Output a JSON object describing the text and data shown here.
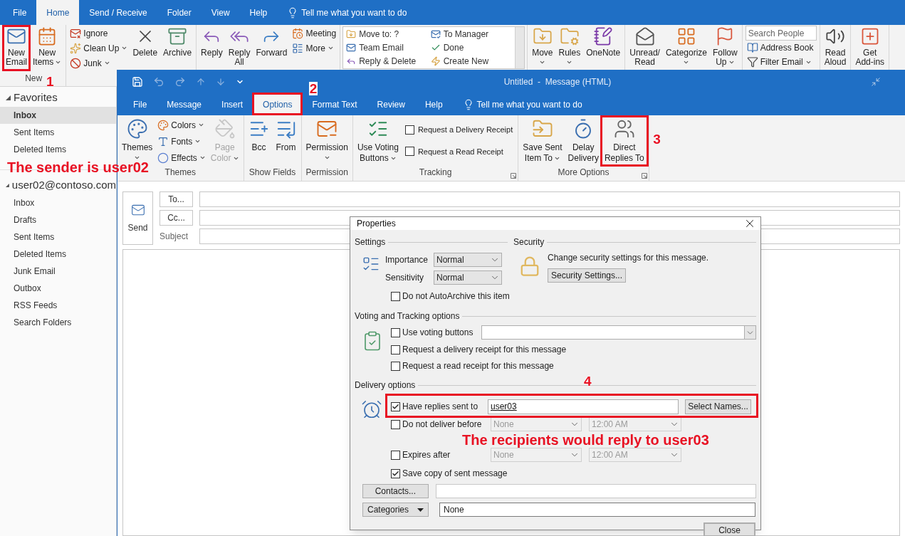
{
  "main_window": {
    "tabs": [
      {
        "label": "File",
        "selected": false
      },
      {
        "label": "Home",
        "selected": true
      },
      {
        "label": "Send / Receive",
        "selected": false
      },
      {
        "label": "Folder",
        "selected": false
      },
      {
        "label": "View",
        "selected": false
      },
      {
        "label": "Help",
        "selected": false
      }
    ],
    "tell_me": "Tell me what you want to do",
    "ribbon_groups": [
      {
        "label": "New",
        "items": [
          {
            "kind": "large",
            "label": "New\nEmail",
            "dropdown": false
          },
          {
            "kind": "large",
            "label": "New\nItems",
            "dropdown": true
          }
        ]
      },
      {
        "items": [
          {
            "kind": "stack",
            "items": [
              {
                "label": "Ignore",
                "dropdown": false
              },
              {
                "label": "Clean Up",
                "dropdown": true
              },
              {
                "label": "Junk",
                "dropdown": true
              }
            ]
          },
          {
            "kind": "large",
            "label": "Delete",
            "dropdown": false
          },
          {
            "kind": "large",
            "label": "Archive",
            "dropdown": false
          }
        ]
      },
      {
        "items": [
          {
            "kind": "large",
            "label": "Reply",
            "dropdown": false
          },
          {
            "kind": "large",
            "label": "Reply\nAll",
            "dropdown": false
          },
          {
            "kind": "large",
            "label": "Forward",
            "dropdown": false
          },
          {
            "kind": "stack",
            "items": [
              {
                "label": "Meeting",
                "dropdown": false
              },
              {
                "label": "More",
                "dropdown": true
              }
            ]
          }
        ]
      },
      {
        "items": [
          {
            "kind": "quicksteps",
            "items": [
              "Move to: ?",
              "To Manager",
              "Team Email",
              "Done",
              "Reply & Delete",
              "Create New"
            ]
          }
        ]
      },
      {
        "items": [
          {
            "kind": "large",
            "label": "Move",
            "dropdown": true
          },
          {
            "kind": "large",
            "label": "Rules",
            "dropdown": true
          },
          {
            "kind": "large",
            "label": "OneNote",
            "dropdown": false
          }
        ]
      },
      {
        "items": [
          {
            "kind": "large",
            "label": "Unread/\nRead",
            "dropdown": false
          },
          {
            "kind": "large",
            "label": "Categorize",
            "dropdown": true
          },
          {
            "kind": "large",
            "label": "Follow\nUp",
            "dropdown": true
          }
        ]
      },
      {
        "items": [
          {
            "kind": "search",
            "placeholder": "Search People"
          },
          {
            "kind": "stack",
            "items": [
              {
                "label": "Address Book",
                "dropdown": false
              },
              {
                "label": "Filter Email",
                "dropdown": true
              }
            ]
          }
        ]
      },
      {
        "items": [
          {
            "kind": "large",
            "label": "Read\nAloud",
            "dropdown": false
          }
        ]
      },
      {
        "items": [
          {
            "kind": "large",
            "label": "Get\nAdd-ins",
            "dropdown": false
          }
        ]
      }
    ]
  },
  "sidebar": {
    "sections": [
      {
        "label": "Favorites",
        "expanded": true,
        "items": [
          {
            "label": "Inbox",
            "selected": true
          },
          {
            "label": "Sent Items",
            "selected": false
          },
          {
            "label": "Deleted Items",
            "selected": false
          }
        ]
      },
      {
        "label": "user02@contoso.com",
        "expanded": true,
        "items": [
          {
            "label": "Inbox",
            "selected": false
          },
          {
            "label": "Drafts",
            "selected": false
          },
          {
            "label": "Sent Items",
            "selected": false
          },
          {
            "label": "Deleted Items",
            "selected": false
          },
          {
            "label": "Junk Email",
            "selected": false
          },
          {
            "label": "Outbox",
            "selected": false
          },
          {
            "label": "RSS Feeds",
            "selected": false
          },
          {
            "label": "Search Folders",
            "selected": false
          }
        ]
      }
    ]
  },
  "message_window": {
    "title": "Untitled  -  Message (HTML)",
    "tabs": [
      {
        "label": "File",
        "selected": false
      },
      {
        "label": "Message",
        "selected": false
      },
      {
        "label": "Insert",
        "selected": false
      },
      {
        "label": "Options",
        "selected": true
      },
      {
        "label": "Format Text",
        "selected": false
      },
      {
        "label": "Review",
        "selected": false
      },
      {
        "label": "Help",
        "selected": false
      }
    ],
    "tell_me": "Tell me what you want to do",
    "ribbon_groups": [
      {
        "label": "Themes",
        "launcher": false,
        "items": [
          {
            "kind": "large",
            "label": "Themes",
            "dropdown": true,
            "disabled": false
          },
          {
            "kind": "stack",
            "items": [
              {
                "label": "Colors",
                "dropdown": true
              },
              {
                "label": "Fonts",
                "dropdown": true
              },
              {
                "label": "Effects",
                "dropdown": true
              }
            ]
          },
          {
            "kind": "large",
            "label": "Page\nColor",
            "dropdown": true,
            "disabled": true
          }
        ]
      },
      {
        "label": "Show Fields",
        "launcher": false,
        "items": [
          {
            "kind": "large",
            "label": "Bcc",
            "dropdown": false,
            "disabled": false
          },
          {
            "kind": "large",
            "label": "From",
            "dropdown": false,
            "disabled": false
          }
        ]
      },
      {
        "label": "Permission",
        "launcher": false,
        "items": [
          {
            "kind": "large",
            "label": "Permission",
            "dropdown": true,
            "disabled": false
          }
        ]
      },
      {
        "label": "Tracking",
        "launcher": true,
        "items": [
          {
            "kind": "large",
            "label": "Use Voting\nButtons",
            "dropdown": true,
            "disabled": false
          },
          {
            "kind": "checks",
            "items": [
              {
                "label": "Request a Delivery Receipt",
                "checked": false
              },
              {
                "label": "Request a Read Receipt",
                "checked": false
              }
            ]
          }
        ]
      },
      {
        "label": "More Options",
        "launcher": true,
        "items": [
          {
            "kind": "large",
            "label": "Save Sent\nItem To",
            "dropdown": true,
            "disabled": false
          },
          {
            "kind": "large",
            "label": "Delay\nDelivery",
            "dropdown": false,
            "disabled": false
          },
          {
            "kind": "large",
            "label": "Direct\nReplies To",
            "dropdown": false,
            "disabled": false
          }
        ]
      }
    ],
    "send_button": "Send",
    "to_button": "To...",
    "cc_button": "Cc...",
    "subject_label": "Subject"
  },
  "dialog": {
    "title": "Properties",
    "settings": {
      "heading": "Settings",
      "importance": {
        "label": "Importance",
        "value": "Normal"
      },
      "sensitivity": {
        "label": "Sensitivity",
        "value": "Normal"
      },
      "autoarchive": {
        "label": "Do not AutoArchive this item",
        "checked": false
      }
    },
    "security": {
      "heading": "Security",
      "text": "Change security settings for this message.",
      "button": "Security Settings..."
    },
    "voting": {
      "heading": "Voting and Tracking options",
      "options": [
        {
          "label": "Use voting buttons",
          "checked": false
        },
        {
          "label": "Request a delivery receipt for this message",
          "checked": false
        },
        {
          "label": "Request a read receipt for this message",
          "checked": false
        }
      ]
    },
    "delivery": {
      "heading": "Delivery options",
      "replies": {
        "label": "Have replies sent to",
        "checked": true,
        "value": "user03",
        "button": "Select Names..."
      },
      "timed": [
        {
          "label": "Do not deliver before",
          "checked": false,
          "date": "None",
          "time": "12:00 AM"
        },
        {
          "label": "Expires after",
          "checked": false,
          "date": "None",
          "time": "12:00 AM"
        }
      ],
      "save_copy": {
        "label": "Save copy of sent message",
        "checked": true
      }
    },
    "contacts_button": "Contacts...",
    "categories_button": "Categories",
    "categories_value": "None",
    "close_button": "Close"
  },
  "annotations": [
    {
      "text": "1"
    },
    {
      "text": "2"
    },
    {
      "text": "3"
    },
    {
      "text": "4"
    },
    {
      "text": "The sender is user02"
    },
    {
      "text": "The recipients would reply to user03"
    }
  ]
}
